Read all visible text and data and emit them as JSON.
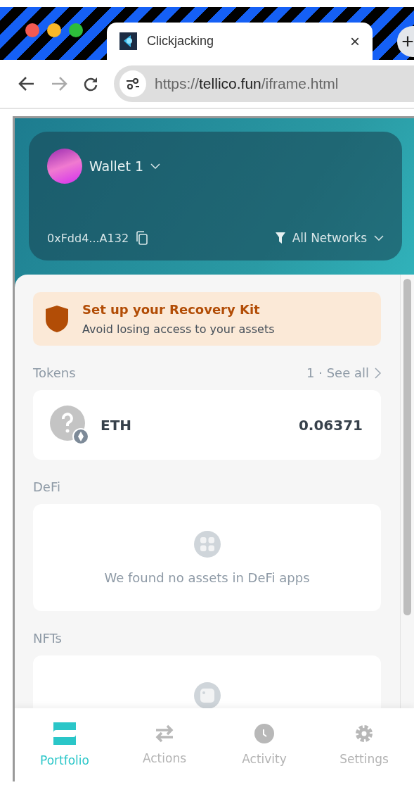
{
  "browser": {
    "tab": {
      "title": "Clickjacking",
      "close": "×"
    },
    "new_tab": "+",
    "address": {
      "scheme": "https://",
      "host": "tellico.fun",
      "path": "/iframe.html"
    }
  },
  "wallet": {
    "name": "Wallet 1",
    "address": "0xFdd4...A132",
    "network": "All Networks"
  },
  "banner": {
    "title": "Set up your Recovery Kit",
    "subtitle": "Avoid losing access to your assets"
  },
  "tokens": {
    "title": "Tokens",
    "link": "1 · See all",
    "items": [
      {
        "symbol": "ETH",
        "amount": "0.06371"
      }
    ]
  },
  "defi": {
    "title": "DeFi",
    "empty": "We found no assets in DeFi apps"
  },
  "nfts": {
    "title": "NFTs"
  },
  "nav": [
    {
      "kind": "portfolio",
      "label": "Portfolio",
      "selected": true
    },
    {
      "kind": "actions",
      "label": "Actions",
      "selected": false
    },
    {
      "kind": "activity",
      "label": "Activity",
      "selected": false
    },
    {
      "kind": "settings",
      "label": "Settings",
      "selected": false
    }
  ]
}
